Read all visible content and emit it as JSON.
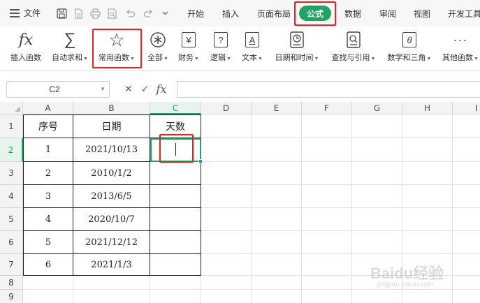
{
  "menubar": {
    "file_label": "文件",
    "tabs": [
      "开始",
      "插入",
      "页面布局",
      "公式",
      "数据",
      "审阅",
      "视图",
      "开发工具"
    ],
    "active_tab": "公式"
  },
  "ribbon": {
    "buttons": [
      {
        "label": "插入函数",
        "icon": "fx-icon",
        "dropdown": false
      },
      {
        "label": "自动求和",
        "icon": "sigma-icon",
        "dropdown": true
      },
      {
        "label": "常用函数",
        "icon": "star-icon",
        "dropdown": true
      },
      {
        "label": "全部",
        "icon": "asterisk-icon",
        "dropdown": true
      },
      {
        "label": "财务",
        "icon": "yen-icon",
        "dropdown": true
      },
      {
        "label": "逻辑",
        "icon": "question-icon",
        "dropdown": true
      },
      {
        "label": "文本",
        "icon": "text-a-icon",
        "dropdown": true
      },
      {
        "label": "日期和时间",
        "icon": "clock-icon",
        "dropdown": true
      },
      {
        "label": "查找与引用",
        "icon": "search-doc-icon",
        "dropdown": true
      },
      {
        "label": "数学和三角",
        "icon": "theta-icon",
        "dropdown": true
      },
      {
        "label": "其他函数",
        "icon": "more-icon",
        "dropdown": true
      }
    ],
    "icon_glyphs": {
      "fx": "fx",
      "sigma": "∑",
      "star": "☆",
      "yen": "¥",
      "question": "?",
      "text": "A",
      "theta": "θ",
      "more": "···"
    }
  },
  "formula_bar": {
    "name_box": "C2",
    "cancel_symbol": "✕",
    "confirm_symbol": "✓",
    "fx_symbol": "fx",
    "content": ""
  },
  "grid": {
    "columns": [
      "A",
      "B",
      "C",
      "D",
      "E",
      "F",
      "G",
      "H",
      "I"
    ],
    "rows": [
      "1",
      "2",
      "3",
      "4",
      "5",
      "6",
      "7",
      "8",
      "9"
    ],
    "selected_cell": "C2",
    "table": {
      "headers": [
        "序号",
        "日期",
        "天数"
      ],
      "rows": [
        [
          "1",
          "2021/10/13",
          ""
        ],
        [
          "2",
          "2010/1/2",
          ""
        ],
        [
          "3",
          "2013/6/5",
          ""
        ],
        [
          "4",
          "2020/10/7",
          ""
        ],
        [
          "5",
          "2021/12/12",
          ""
        ],
        [
          "6",
          "2021/1/3",
          ""
        ]
      ]
    }
  },
  "watermark": {
    "line1": "Baidu经验",
    "line2": "jingyan.baidu.com"
  },
  "colors": {
    "accent": "#1fa463",
    "highlight": "#e8231d"
  }
}
